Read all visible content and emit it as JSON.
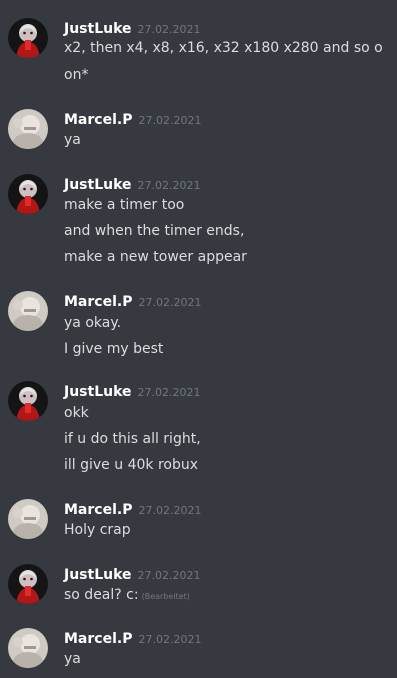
{
  "users": {
    "luke": {
      "name": "JustLuke"
    },
    "marcel": {
      "name": "Marcel.P"
    }
  },
  "messages": [
    {
      "user": "JustLuke",
      "time": "27.02.2021",
      "lines": [
        "x2, then x4, x8, x16, x32 x180 x280 and so o",
        "on*"
      ]
    },
    {
      "user": "Marcel.P",
      "time": "27.02.2021",
      "lines": [
        "ya"
      ]
    },
    {
      "user": "JustLuke",
      "time": "27.02.2021",
      "lines": [
        "make a timer too",
        "and when the timer ends,",
        "make a new tower appear"
      ]
    },
    {
      "user": "Marcel.P",
      "time": "27.02.2021",
      "lines": [
        "ya okay.",
        "I give my best"
      ]
    },
    {
      "user": "JustLuke",
      "time": "27.02.2021",
      "lines": [
        "okk",
        "if u do this all right,",
        "ill give u 40k robux"
      ]
    },
    {
      "user": "Marcel.P",
      "time": "27.02.2021",
      "lines": [
        "Holy crap"
      ]
    },
    {
      "user": "JustLuke",
      "time": "27.02.2021",
      "lines": [
        "so deal? c:"
      ],
      "edited_label": "(Bearbeitet)"
    },
    {
      "user": "Marcel.P",
      "time": "27.02.2021",
      "lines": [
        "ya"
      ]
    }
  ],
  "colors": {
    "background": "#36393f",
    "username": "#ffffff",
    "text": "#dcddde",
    "timestamp": "#72767d"
  }
}
